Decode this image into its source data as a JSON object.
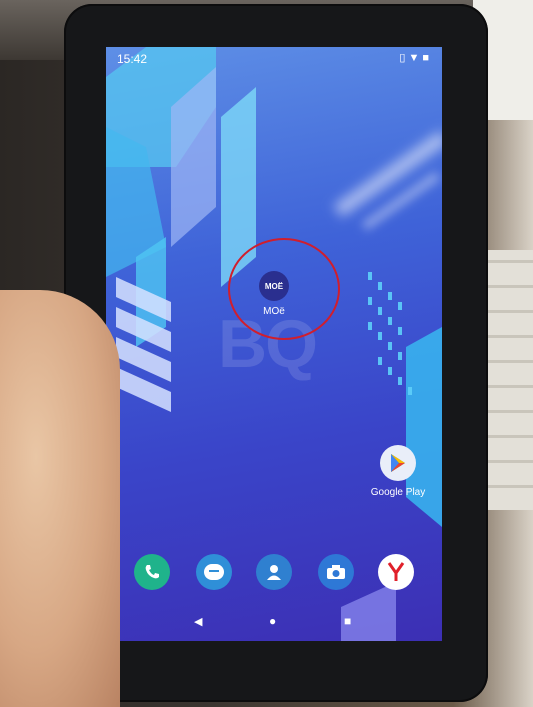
{
  "status_bar": {
    "time": "15:42",
    "icons": [
      "vibrate-icon",
      "wifi-icon",
      "battery-icon"
    ]
  },
  "wallpaper": {
    "watermark": "BQ"
  },
  "home_apps": [
    {
      "id": "moe",
      "icon_text": "MOЁ",
      "label": "МОё"
    },
    {
      "id": "google-play",
      "label": "Google Play"
    }
  ],
  "dock": [
    {
      "id": "phone",
      "icon": "phone-icon",
      "color": "#1fb38b"
    },
    {
      "id": "messages",
      "icon": "messages-icon",
      "color": "#2f8fd8"
    },
    {
      "id": "contacts",
      "icon": "contacts-icon",
      "color": "#2f80d0"
    },
    {
      "id": "camera",
      "icon": "camera-icon",
      "color": "#2e78d6"
    },
    {
      "id": "yandex",
      "icon": "yandex-icon",
      "color": "#ffffff"
    }
  ],
  "nav_bar": {
    "back": "◀",
    "home": "●",
    "recents": "■"
  },
  "colors": {
    "highlight_ring": "#d01e2d",
    "screen_top": "#5e8fe6",
    "screen_bottom": "#3c2fb4"
  }
}
